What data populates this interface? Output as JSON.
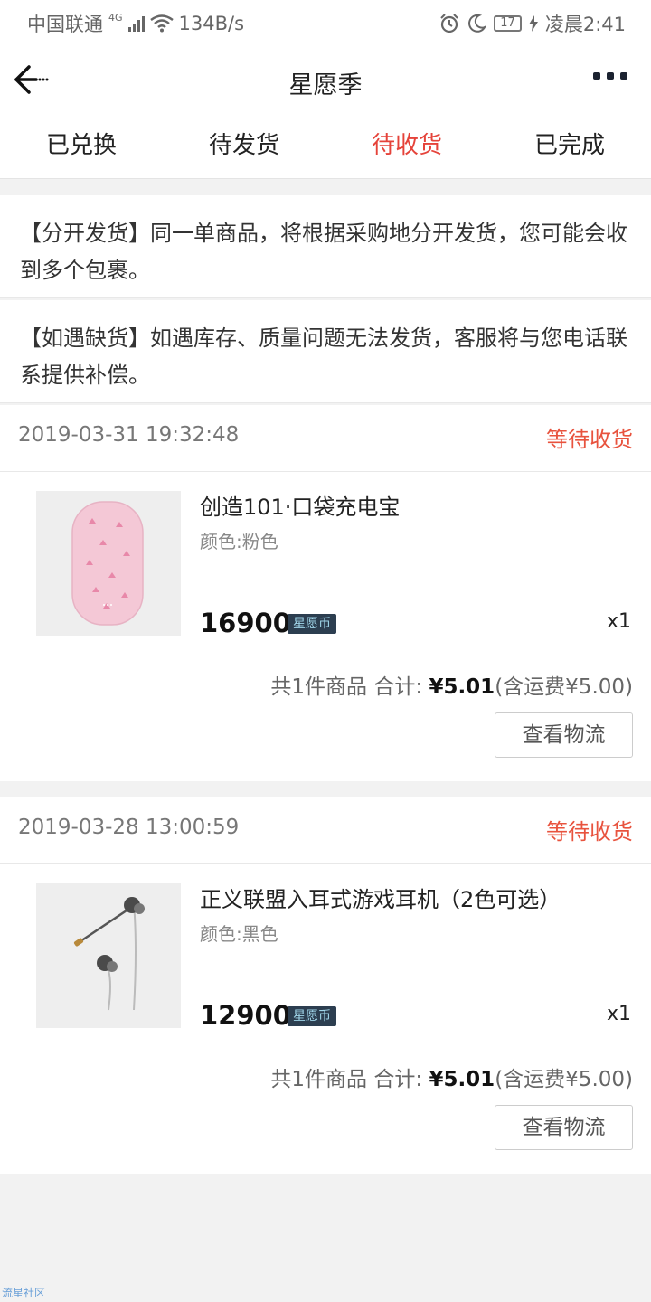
{
  "status_bar": {
    "carrier": "中国联通",
    "network": "4G",
    "speed": "134B/s",
    "battery": "17",
    "time": "凌晨2:41"
  },
  "nav": {
    "title": "星愿季"
  },
  "tabs": [
    {
      "label": "已兑换",
      "active": false
    },
    {
      "label": "待发货",
      "active": false
    },
    {
      "label": "待收货",
      "active": true
    },
    {
      "label": "已完成",
      "active": false
    }
  ],
  "notices": [
    "【分开发货】同一单商品，将根据采购地分开发货，您可能会收到多个包裹。",
    "【如遇缺货】如遇库存、质量问题无法发货，客服将与您电话联系提供补偿。"
  ],
  "orders": [
    {
      "time": "2019-03-31 19:32:48",
      "status": "等待收货",
      "product_name": "创造101·口袋充电宝",
      "spec": "颜色:粉色",
      "price": "16900",
      "coin_label": "星愿币",
      "qty": "x1",
      "summary_prefix": "共1件商品 合计: ",
      "amount": "¥5.01",
      "shipping": "(含运费¥5.00)",
      "button": "查看物流"
    },
    {
      "time": "2019-03-28 13:00:59",
      "status": "等待收货",
      "product_name": "正义联盟入耳式游戏耳机（2色可选）",
      "spec": "颜色:黑色",
      "price": "12900",
      "coin_label": "星愿币",
      "qty": "x1",
      "summary_prefix": "共1件商品 合计: ",
      "amount": "¥5.01",
      "shipping": "(含运费¥5.00)",
      "button": "查看物流"
    }
  ],
  "watermark": "流星社区",
  "colors": {
    "accent": "#e5433a",
    "status": "#e8533e",
    "coin_badge_bg": "#2c3e50"
  },
  "icons": {
    "back": "arrow-left-icon",
    "more": "more-dots-icon",
    "wifi": "wifi-icon",
    "alarm": "alarm-icon",
    "moon": "moon-icon",
    "charging": "charging-bolt-icon"
  }
}
